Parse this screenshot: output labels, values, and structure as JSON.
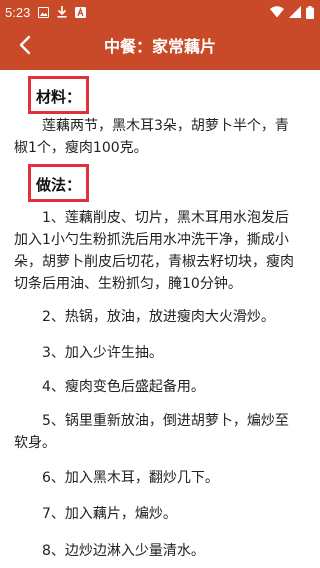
{
  "status_bar": {
    "time": "5:23",
    "left_icons": [
      "image-icon",
      "download-icon",
      "app-a-icon"
    ],
    "right_icons": [
      "wifi-icon",
      "signal-icon",
      "battery-icon"
    ]
  },
  "app_bar": {
    "title": "中餐：家常藕片",
    "background_color": "#c94a28"
  },
  "sections": {
    "materials": {
      "heading": "材料：",
      "text": "莲藕两节，黑木耳3朵，胡萝卜半个，青椒1个，瘦肉100克。"
    },
    "method": {
      "heading": "做法：",
      "steps": [
        "1、莲藕削皮、切片，黑木耳用水泡发后加入1小勺生粉抓洗后用水冲洗干净，撕成小朵，胡萝卜削皮后切花，青椒去籽切块，瘦肉切条后用油、生粉抓匀，腌10分钟。",
        "2、热锅，放油，放进瘦肉大火滑炒。",
        "3、加入少许生抽。",
        "4、瘦肉变色后盛起备用。",
        "5、锅里重新放油，倒进胡萝卜，煸炒至软身。",
        "6、加入黑木耳，翻炒几下。",
        "7、加入藕片，煸炒。",
        "8、边炒边淋入少量清水。"
      ]
    }
  },
  "highlight_color": "#e0303a"
}
